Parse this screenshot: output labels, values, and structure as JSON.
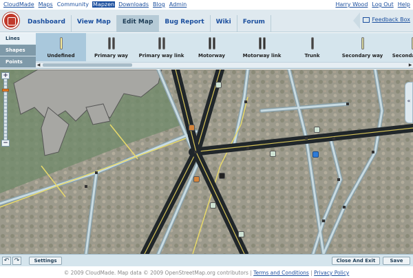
{
  "top": {
    "links": [
      "CloudMade",
      "Maps",
      "Community",
      "Mapzen",
      "Downloads",
      "Blog",
      "Admin"
    ],
    "active_link": "Mapzen",
    "user": [
      "Harry Wood",
      "Log Out",
      "Help"
    ]
  },
  "nav": {
    "tabs": [
      "Dashboard",
      "View Map",
      "Edit Map",
      "Bug Report",
      "Wiki",
      "Forum"
    ],
    "active_tab": "Edit Map",
    "feedback": "Feedback Box"
  },
  "features": {
    "categories": [
      "Lines",
      "Shapes",
      "Points"
    ],
    "active_category": "Lines",
    "way_types": [
      {
        "label": "Undefined",
        "colors": [
          "#f5eb9a"
        ]
      },
      {
        "label": "Primary way",
        "colors": [
          "#444",
          "#444"
        ]
      },
      {
        "label": "Primary way link",
        "colors": [
          "#444",
          "#444"
        ]
      },
      {
        "label": "Motorway",
        "colors": [
          "#333",
          "#333"
        ]
      },
      {
        "label": "Motorway link",
        "colors": [
          "#333",
          "#333"
        ]
      },
      {
        "label": "Trunk",
        "colors": [
          "#444"
        ]
      },
      {
        "label": "Secondary way",
        "colors": [
          "#cfcf9a"
        ]
      },
      {
        "label": "Secondary way",
        "colors": [
          "#cfcf9a"
        ]
      }
    ],
    "active_way": "Undefined"
  },
  "map": {
    "zoom_in": "+",
    "zoom_out": "−",
    "side_toggle": "«"
  },
  "bottom": {
    "undo": "↶",
    "redo": "↷",
    "settings": "Settings",
    "close_exit": "Close And Exit",
    "save": "Save"
  },
  "footer": {
    "copyright": "© 2009 CloudMade. Map data © 2009 OpenStreetMap.org contributors |",
    "terms": "Terms and Conditions",
    "sep": "|",
    "privacy": "Privacy Policy"
  }
}
